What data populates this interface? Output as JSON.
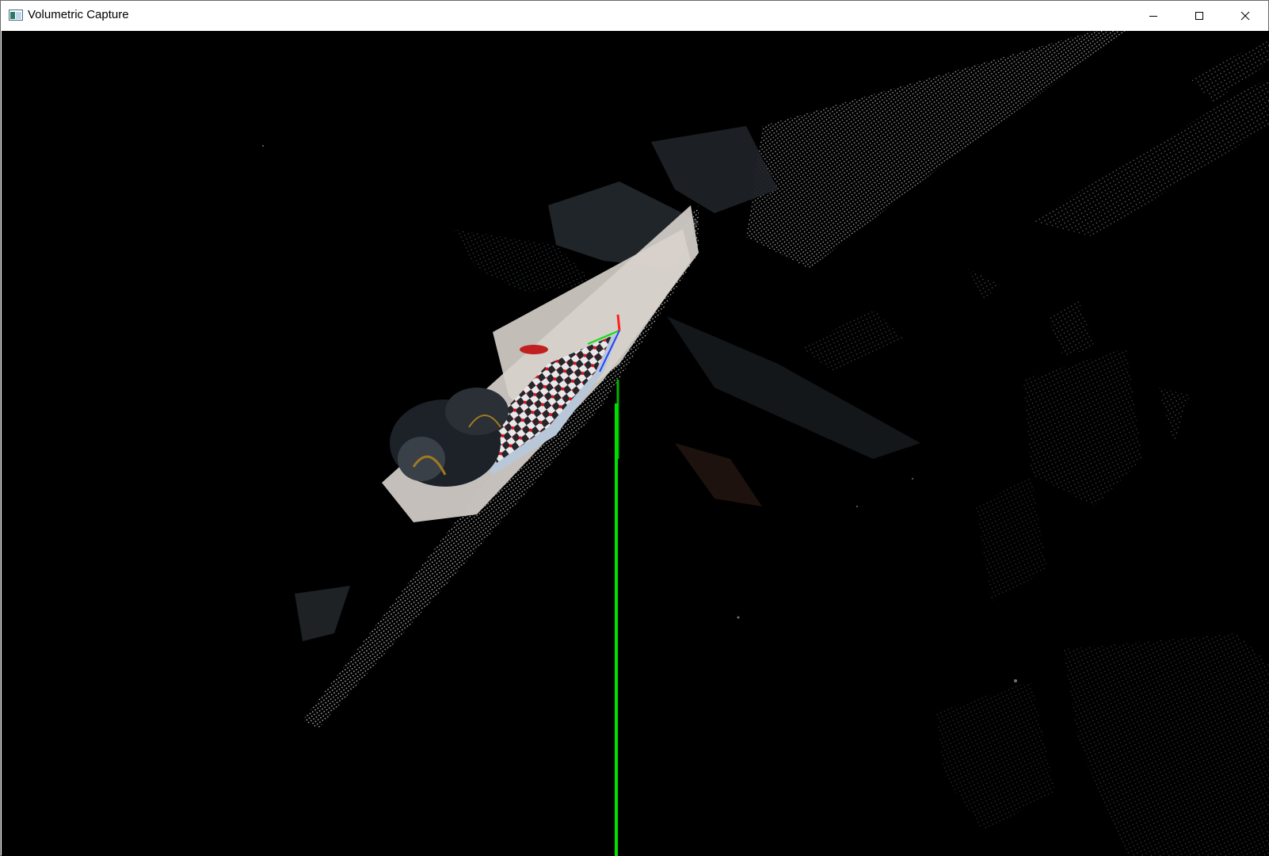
{
  "window": {
    "title": "Volumetric Capture",
    "icon": "app-window-icon",
    "controls": [
      {
        "name": "minimize",
        "icon": "minimize-icon"
      },
      {
        "name": "maximize",
        "icon": "maximize-icon"
      },
      {
        "name": "close",
        "icon": "close-icon"
      }
    ]
  },
  "viewport": {
    "background": "#000000",
    "content": "3d-point-cloud",
    "axis_colors": {
      "x": "#ff2020",
      "y": "#00e000",
      "z": "#2040ff"
    }
  }
}
